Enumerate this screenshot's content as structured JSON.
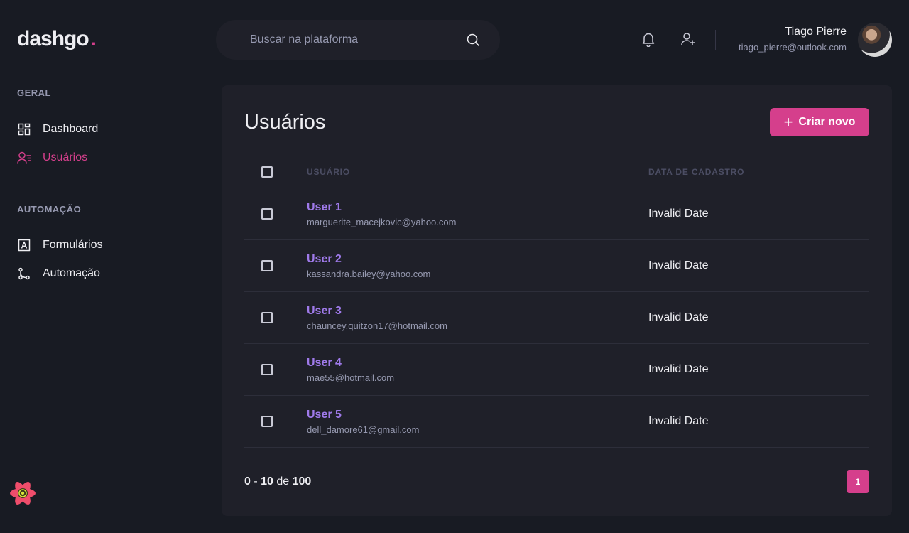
{
  "brand": {
    "name": "dashgo",
    "dot": ".",
    "accent": "#d53f8c"
  },
  "search": {
    "placeholder": "Buscar na plataforma",
    "value": ""
  },
  "header": {
    "icons": [
      "bell-icon",
      "user-add-icon"
    ],
    "profile": {
      "name": "Tiago Pierre",
      "email": "tiago_pierre@outlook.com"
    }
  },
  "sidebar": {
    "sections": [
      {
        "title": "GERAL",
        "items": [
          {
            "label": "Dashboard",
            "icon": "dashboard-icon",
            "active": false
          },
          {
            "label": "Usuários",
            "icon": "users-icon",
            "active": true
          }
        ]
      },
      {
        "title": "AUTOMAÇÃO",
        "items": [
          {
            "label": "Formulários",
            "icon": "form-icon",
            "active": false
          },
          {
            "label": "Automação",
            "icon": "automation-icon",
            "active": false
          }
        ]
      }
    ]
  },
  "main": {
    "title": "Usuários",
    "create_button": "Criar novo",
    "table": {
      "headers": {
        "user": "USUÁRIO",
        "date": "DATA DE CADASTRO"
      },
      "rows": [
        {
          "name": "User 1",
          "email": "marguerite_macejkovic@yahoo.com",
          "date": "Invalid Date"
        },
        {
          "name": "User 2",
          "email": "kassandra.bailey@yahoo.com",
          "date": "Invalid Date"
        },
        {
          "name": "User 3",
          "email": "chauncey.quitzon17@hotmail.com",
          "date": "Invalid Date"
        },
        {
          "name": "User 4",
          "email": "mae55@hotmail.com",
          "date": "Invalid Date"
        },
        {
          "name": "User 5",
          "email": "dell_damore61@gmail.com",
          "date": "Invalid Date"
        }
      ]
    },
    "pagination": {
      "from": "0",
      "to": "10",
      "of_label": "de",
      "total": "100",
      "current_page": "1"
    }
  },
  "colors": {
    "background": "#181b23",
    "card": "#1f2029",
    "accent": "#d53f8c",
    "link": "#9f7aea"
  }
}
